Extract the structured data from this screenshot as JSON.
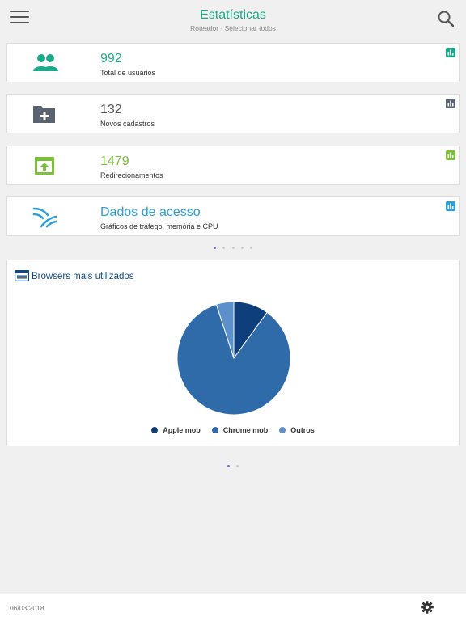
{
  "header": {
    "title": "Estatísticas",
    "subtitle": "Roteador - Selecionar todos"
  },
  "stats": [
    {
      "value": "992",
      "label": "Total de usuários",
      "color": "#1aaa8a",
      "icon": "users-icon"
    },
    {
      "value": "132",
      "label": "Novos cadastros",
      "color": "#555555",
      "icon": "folder-add-icon"
    },
    {
      "value": "1479",
      "label": "Redirecionamentos",
      "color": "#7cbf3a",
      "icon": "redirect-icon"
    },
    {
      "value": "Dados de acesso",
      "label": "Gráficos de tráfego, memória e CPU",
      "color": "#2aa0dc",
      "icon": "wifi-icon"
    }
  ],
  "stats_pager": {
    "pages": 5,
    "current": 1
  },
  "browsers": {
    "title": "Browsers mais utilizados",
    "icon": "browser-window-icon",
    "pager": {
      "pages": 2,
      "current": 1
    }
  },
  "chart_data": {
    "type": "pie",
    "title": "Browsers mais utilizados",
    "legend_position": "bottom",
    "slices": [
      {
        "name": "Apple mob",
        "value": 10,
        "color": "#0e3f7c"
      },
      {
        "name": "Chrome mob",
        "value": 85,
        "color": "#2f6aa9"
      },
      {
        "name": "Outros",
        "value": 5,
        "color": "#5b90cb"
      }
    ]
  },
  "footer": {
    "date": "06/03/2018",
    "settings_icon": "gear-icon"
  }
}
